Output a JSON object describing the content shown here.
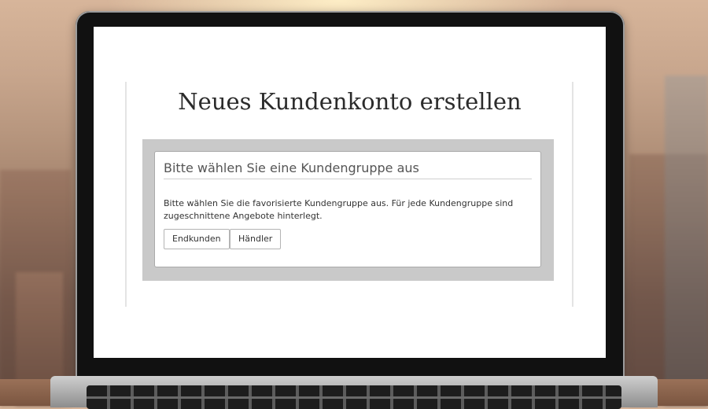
{
  "page": {
    "title": "Neues Kundenkonto erstellen"
  },
  "customer_group": {
    "heading": "Bitte wählen Sie eine Kundengruppe aus",
    "description": "Bitte wählen Sie die favorisierte Kundengruppe aus. Für jede Kundengruppe sind zugeschnittene Angebote hinterlegt.",
    "buttons": {
      "end_customer": "Endkunden",
      "dealer": "Händler"
    }
  },
  "colors": {
    "panel_gray": "#c9c9c9",
    "card_border": "#a9a9a9",
    "title_text": "#2b2b2b"
  }
}
